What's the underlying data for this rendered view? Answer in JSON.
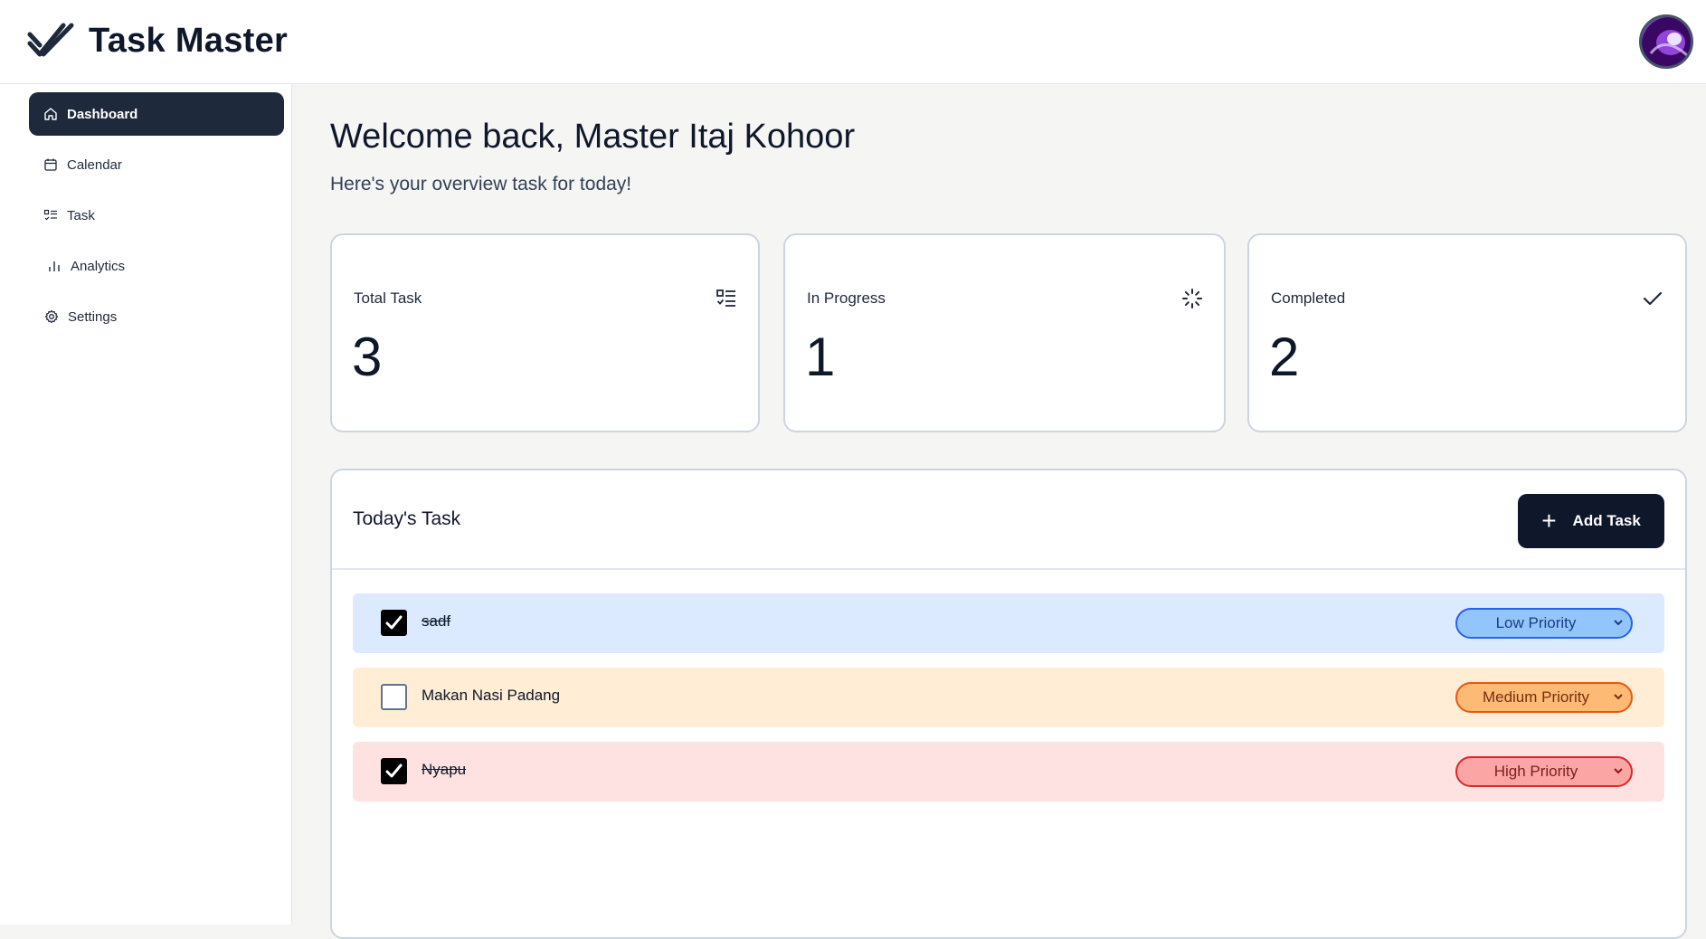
{
  "app": {
    "title": "Task Master"
  },
  "sidebar": {
    "items": [
      {
        "label": "Dashboard",
        "icon": "home-icon",
        "active": true
      },
      {
        "label": "Calendar",
        "icon": "calendar-icon",
        "active": false
      },
      {
        "label": "Task",
        "icon": "list-check-icon",
        "active": false
      },
      {
        "label": "Analytics",
        "icon": "bar-chart-icon",
        "active": false
      },
      {
        "label": "Settings",
        "icon": "gear-icon",
        "active": false
      }
    ]
  },
  "main": {
    "title": "Welcome back, Master Itaj Kohoor",
    "subtitle": "Here's your overview task for today!"
  },
  "stats": [
    {
      "label": "Total Task",
      "value": "3",
      "icon": "list-check-icon"
    },
    {
      "label": "In Progress",
      "value": "1",
      "icon": "loader-icon"
    },
    {
      "label": "Completed",
      "value": "2",
      "icon": "check-icon"
    }
  ],
  "tasks_panel": {
    "title": "Today's Task",
    "add_button": "Add Task",
    "rows": [
      {
        "name": "sadf",
        "done": true,
        "priority": "Low Priority",
        "bg": "#dbeafe",
        "pill_bg": "#93c5fd",
        "pill_border": "#2563eb",
        "pill_text": "#1e3a8a"
      },
      {
        "name": "Makan Nasi Padang",
        "done": false,
        "priority": "Medium Priority",
        "bg": "#ffedd5",
        "pill_bg": "#fdba74",
        "pill_border": "#ea580c",
        "pill_text": "#7c2d12"
      },
      {
        "name": "Nyapu",
        "done": true,
        "priority": "High Priority",
        "bg": "#fee2e2",
        "pill_bg": "#fca5a5",
        "pill_border": "#dc2626",
        "pill_text": "#7f1d1d"
      }
    ]
  },
  "colors": {
    "accent": "#0f172a",
    "active_nav": "#1e293b"
  }
}
